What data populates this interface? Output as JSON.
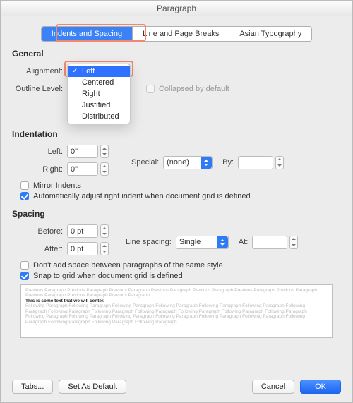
{
  "window": {
    "title": "Paragraph"
  },
  "tabs": [
    {
      "label": "Indents and Spacing",
      "active": true
    },
    {
      "label": "Line and Page Breaks",
      "active": false
    },
    {
      "label": "Asian Typography",
      "active": false
    }
  ],
  "general": {
    "heading": "General",
    "alignment_label": "Alignment:",
    "alignment_value": "Left",
    "alignment_options": [
      "Left",
      "Centered",
      "Right",
      "Justified",
      "Distributed"
    ],
    "outline_label": "Outline Level:",
    "collapsed_label": "Collapsed by default",
    "collapsed_checked": false,
    "collapsed_enabled": false
  },
  "indentation": {
    "heading": "Indentation",
    "left_label": "Left:",
    "left_value": "0\"",
    "right_label": "Right:",
    "right_value": "0\"",
    "special_label": "Special:",
    "special_value": "(none)",
    "by_label": "By:",
    "by_value": "",
    "mirror_label": "Mirror Indents",
    "mirror_checked": false,
    "auto_label": "Automatically adjust right indent when document grid is defined",
    "auto_checked": true
  },
  "spacing": {
    "heading": "Spacing",
    "before_label": "Before:",
    "before_value": "0 pt",
    "after_label": "After:",
    "after_value": "0 pt",
    "linespacing_label": "Line spacing:",
    "linespacing_value": "Single",
    "at_label": "At:",
    "at_value": "",
    "nospace_label": "Don't add space between paragraphs of the same style",
    "nospace_checked": false,
    "snap_label": "Snap to grid when document grid is defined",
    "snap_checked": true
  },
  "preview": {
    "prev_line": "Previous Paragraph Previous Paragraph Previous Paragraph Previous Paragraph Previous Paragraph Previous Paragraph Previous Paragraph Previous Paragraph Previous Paragraph Previous Paragraph",
    "sample": "This is some text that we will center.",
    "next_line": "Following Paragraph Following Paragraph Following Paragraph Following Paragraph Following Paragraph Following Paragraph Following Paragraph Following Paragraph Following Paragraph Following Paragraph Following Paragraph Following Paragraph Following Paragraph Following Paragraph Following Paragraph Following Paragraph Following Paragraph Following Paragraph Following Paragraph Following Paragraph Following Paragraph Following Paragraph Following Paragraph"
  },
  "footer": {
    "tabs": "Tabs...",
    "default": "Set As Default",
    "cancel": "Cancel",
    "ok": "OK"
  }
}
